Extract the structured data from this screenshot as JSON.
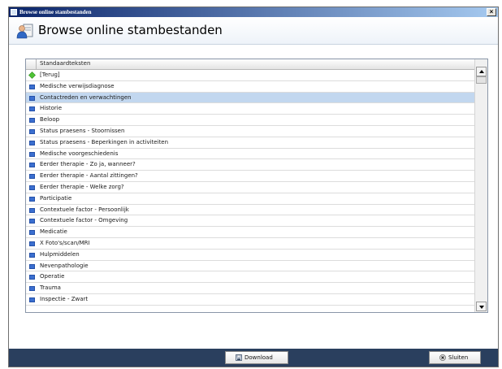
{
  "window": {
    "title": "Browse online stambestanden",
    "close_glyph": "×"
  },
  "header": {
    "title": "Browse online stambestanden",
    "icon": "person-document-icon"
  },
  "list": {
    "column_header": "Standaardteksten",
    "items": [
      {
        "label": "[Terug]",
        "icon": "back-arrow-icon",
        "selected": false
      },
      {
        "label": "Medische verwijsdiagnose",
        "icon": "folder-icon",
        "selected": false
      },
      {
        "label": "Contactreden en verwachtingen",
        "icon": "folder-icon",
        "selected": true
      },
      {
        "label": "Historie",
        "icon": "folder-icon",
        "selected": false
      },
      {
        "label": "Beloop",
        "icon": "folder-icon",
        "selected": false
      },
      {
        "label": "Status praesens - Stoornissen",
        "icon": "folder-icon",
        "selected": false
      },
      {
        "label": "Status praesens - Beperkingen in activiteiten",
        "icon": "folder-icon",
        "selected": false
      },
      {
        "label": "Medische voorgeschiedenis",
        "icon": "folder-icon",
        "selected": false
      },
      {
        "label": "Eerder therapie - Zo ja, wanneer?",
        "icon": "folder-icon",
        "selected": false
      },
      {
        "label": "Eerder therapie - Aantal zittingen?",
        "icon": "folder-icon",
        "selected": false
      },
      {
        "label": "Eerder therapie - Welke zorg?",
        "icon": "folder-icon",
        "selected": false
      },
      {
        "label": "Participatie",
        "icon": "folder-icon",
        "selected": false
      },
      {
        "label": "Contextuele factor - Persoonlijk",
        "icon": "folder-icon",
        "selected": false
      },
      {
        "label": "Contextuele factor - Omgeving",
        "icon": "folder-icon",
        "selected": false
      },
      {
        "label": "Medicatie",
        "icon": "folder-icon",
        "selected": false
      },
      {
        "label": "X Foto's/scan/MRI",
        "icon": "folder-icon",
        "selected": false
      },
      {
        "label": "Hulpmiddelen",
        "icon": "folder-icon",
        "selected": false
      },
      {
        "label": "Nevenpathologie",
        "icon": "folder-icon",
        "selected": false
      },
      {
        "label": "Operatie",
        "icon": "folder-icon",
        "selected": false
      },
      {
        "label": "Trauma",
        "icon": "folder-icon",
        "selected": false
      },
      {
        "label": "Inspectie - Zwart",
        "icon": "folder-icon",
        "selected": false
      }
    ]
  },
  "footer": {
    "download_label": "Download",
    "close_label": "Sluiten"
  },
  "colors": {
    "selected_row": "#c2d7ef",
    "footer_bar": "#2a3f5e",
    "titlebar_start": "#0a246a"
  }
}
